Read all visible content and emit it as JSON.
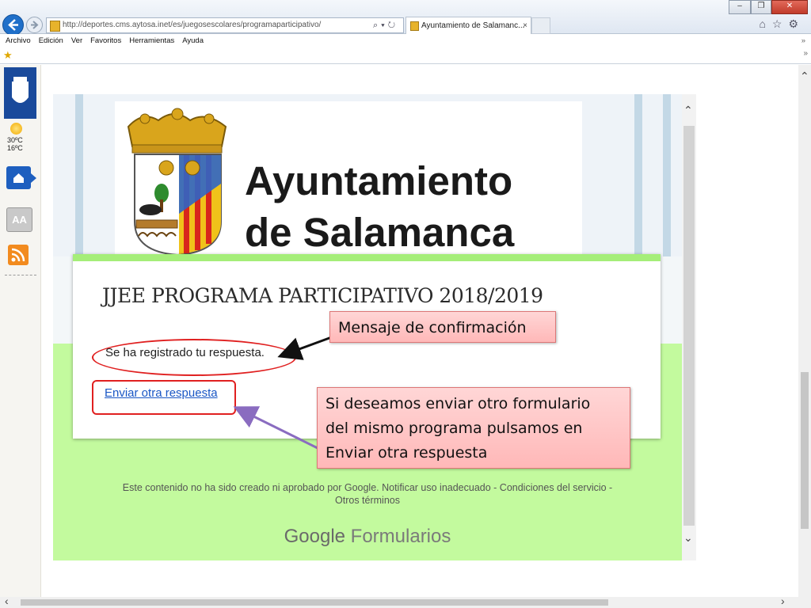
{
  "browser": {
    "url": "http://deportes.cms.aytosa.inet/es/juegosescolares/programaparticipativo/",
    "tab_title": "Ayuntamiento de Salamanc...",
    "tab_close": "×",
    "menu": [
      "Archivo",
      "Edición",
      "Ver",
      "Favoritos",
      "Herramientas",
      "Ayuda"
    ],
    "menu_more": "»"
  },
  "sidebar": {
    "temp_high": "30ºC",
    "temp_low": "16ºC",
    "text_size_label": "AA"
  },
  "header": {
    "line1": "Ayuntamiento",
    "line2": "de Salamanca"
  },
  "form": {
    "title": "JJEE PROGRAMA PARTICIPATIVO 2018/2019",
    "confirmation": "Se ha registrado tu respuesta.",
    "send_again": "Enviar otra respuesta"
  },
  "annotations": {
    "note1": "Mensaje de confirmación",
    "note2_lines": [
      "Si deseamos enviar otro formulario",
      "del mismo programa pulsamos en",
      "Enviar otra respuesta"
    ]
  },
  "footer": {
    "line1": "Este contenido no ha sido creado ni aprobado por Google. Notificar uso inadecuado - Condiciones del servicio -",
    "line2": "Otros términos",
    "brand_google": "Google",
    "brand_forms": "Formularios"
  },
  "colors": {
    "accent_green": "#a5ee79",
    "page_green": "#c3fa9e",
    "link_blue": "#1a57c5",
    "highlight_red": "#e02020",
    "note_pink": "#ffb8b8"
  }
}
